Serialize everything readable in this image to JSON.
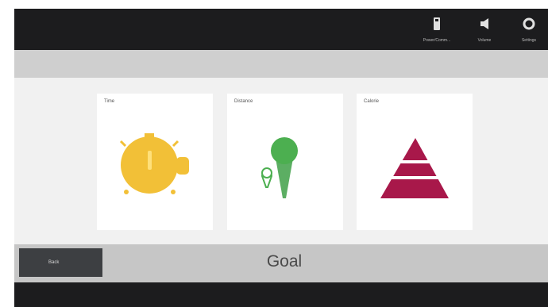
{
  "topbar": {
    "buttons": [
      {
        "label": "Power/Comm...",
        "icon": "remote-icon"
      },
      {
        "label": "Volume",
        "icon": "volume-icon"
      },
      {
        "label": "Settings",
        "icon": "settings-icon"
      }
    ]
  },
  "cards": [
    {
      "label": "Time",
      "icon": "stopwatch-icon",
      "color": "#f2c037"
    },
    {
      "label": "Distance",
      "icon": "map-pin-icon",
      "color": "#4caf50"
    },
    {
      "label": "Calorie",
      "icon": "pyramid-icon",
      "color": "#a8184a"
    }
  ],
  "bottom": {
    "back_label": "Back",
    "title": "Goal"
  }
}
